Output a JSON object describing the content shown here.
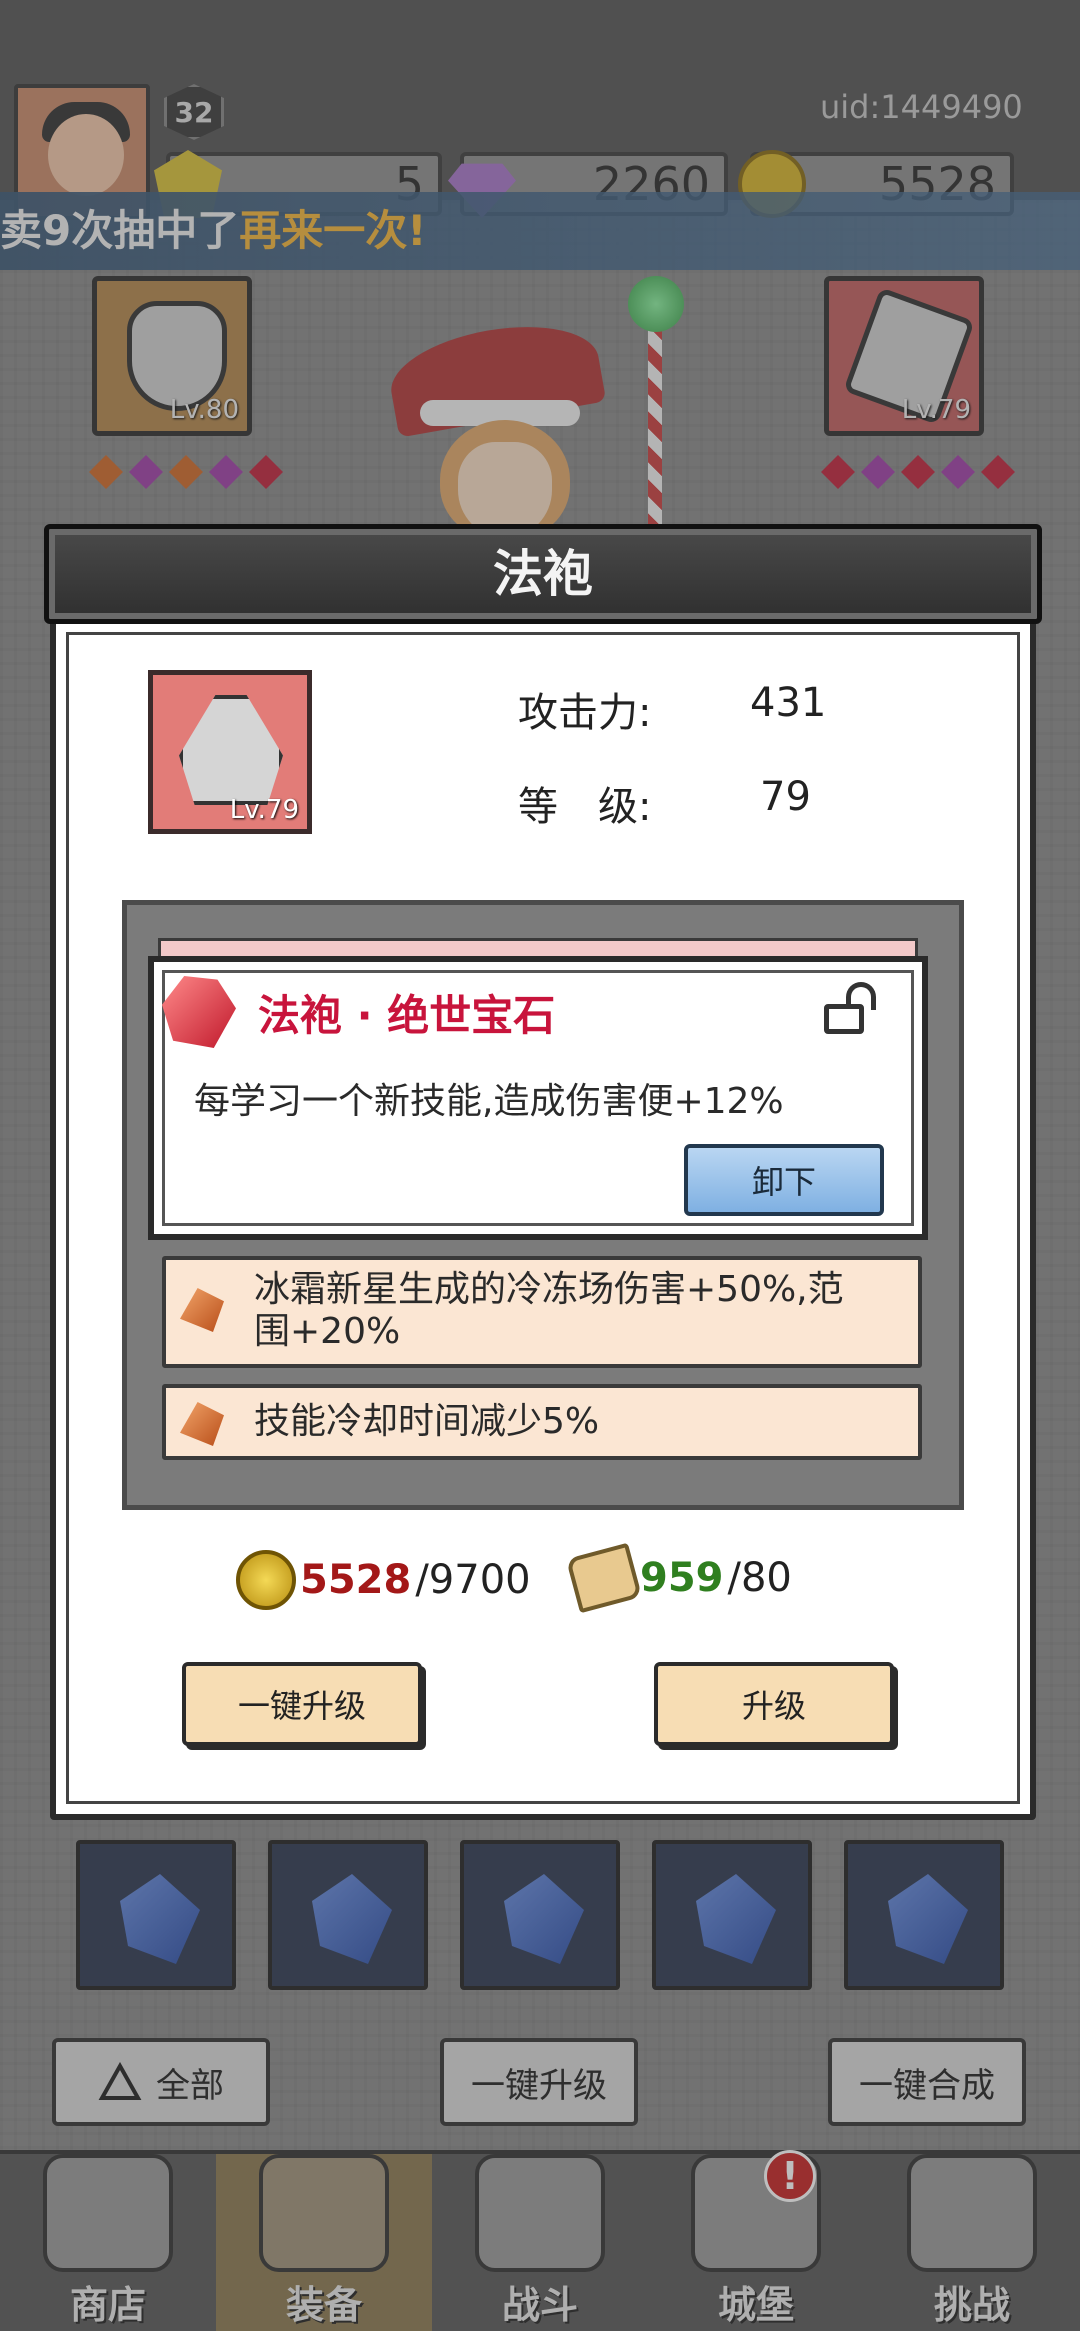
{
  "header": {
    "level": "32",
    "uid": "uid:1449490",
    "resources": [
      {
        "icon": "yellow-gem-icon",
        "value": "5"
      },
      {
        "icon": "purple-gem-icon",
        "value": "2260"
      },
      {
        "icon": "gold-coin-icon",
        "value": "5528"
      }
    ]
  },
  "banner": {
    "prefix": "卖9次抽中了",
    "highlight": "再来一次!"
  },
  "equipment": {
    "left_slot_level": "Lv.80",
    "right_slot_level": "Lv.79"
  },
  "modal": {
    "title": "法袍",
    "item_level": "Lv.79",
    "stats": [
      {
        "label": "攻击力:",
        "value": "431"
      },
      {
        "label": "等　级:",
        "value": "79"
      }
    ],
    "gem": {
      "title": "法袍 · 绝世宝石",
      "description": "每学习一个新技能,造成伤害便+12%",
      "unequip_label": "卸下"
    },
    "effects": [
      {
        "text_line1": "冰霜新星生成的冷冻场伤害+50%,范",
        "text_line2": "围+20%"
      },
      {
        "text_line1": "技能冷却时间减少5%",
        "text_line2": ""
      }
    ],
    "costs": {
      "gold_have": "5528",
      "gold_need": "/9700",
      "scroll_have": "959",
      "scroll_need": "/80"
    },
    "buttons": {
      "one_click_upgrade": "一键升级",
      "upgrade": "升级"
    }
  },
  "bottom_actions": {
    "filter_label": "全部",
    "one_click_upgrade": "一键升级",
    "one_click_merge": "一键合成"
  },
  "nav": {
    "items": [
      {
        "label": "商店",
        "icon": "shop-icon"
      },
      {
        "label": "装备",
        "icon": "bag-icon"
      },
      {
        "label": "战斗",
        "icon": "swords-icon"
      },
      {
        "label": "城堡",
        "icon": "castle-icon"
      },
      {
        "label": "挑战",
        "icon": "shield-icon"
      }
    ],
    "badge": "!"
  }
}
